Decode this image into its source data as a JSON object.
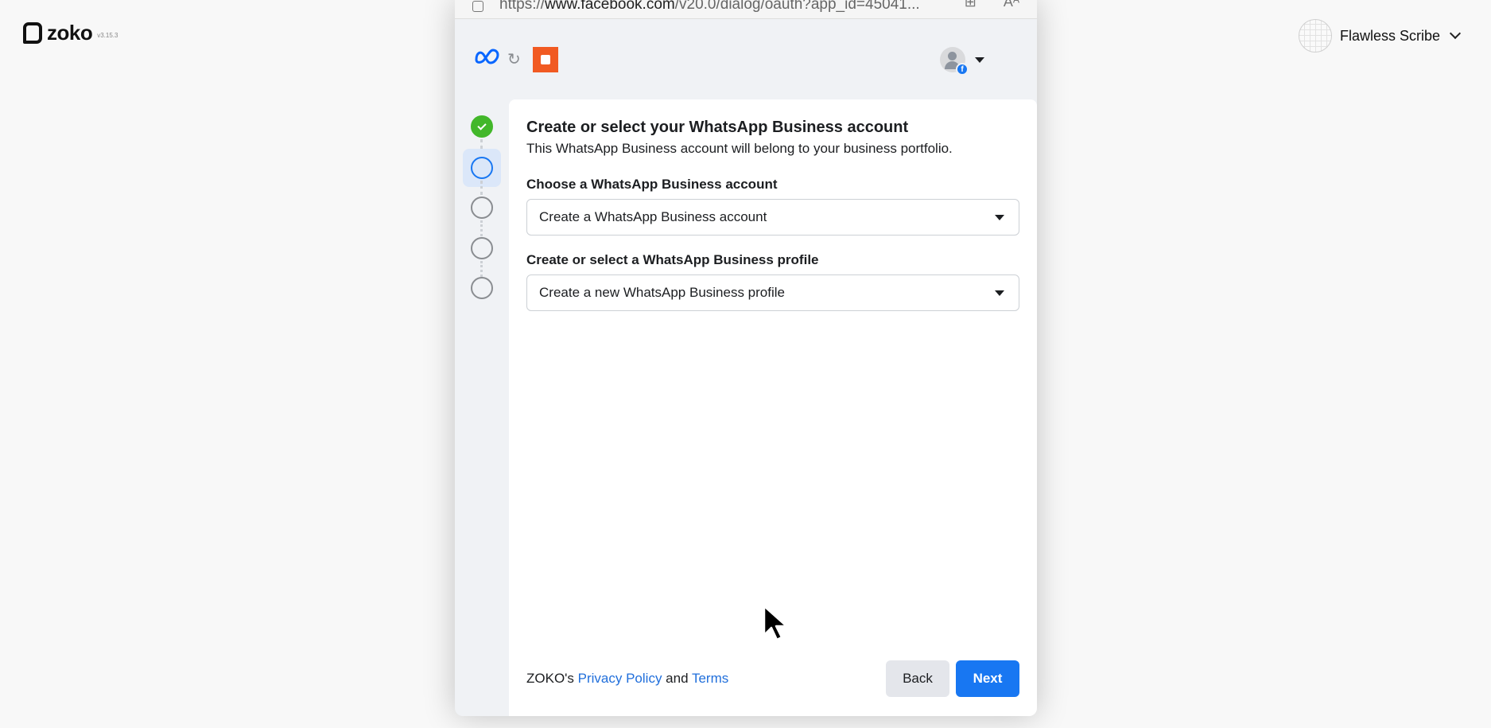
{
  "app": {
    "logo_text": "zoko",
    "version": "v3.15.3",
    "user_name": "Flawless Scribe"
  },
  "popup": {
    "url_prefix": "https://",
    "url_domain": "www.facebook.com",
    "url_path": "/v20.0/dialog/oauth?app_id=45041...",
    "swap_icon": "↻",
    "fb_badge": "f"
  },
  "steps": {
    "total": 5,
    "completed": 1,
    "current": 2
  },
  "card": {
    "title": "Create or select your WhatsApp Business account",
    "subtitle": "This WhatsApp Business account will belong to your business portfolio.",
    "account_label": "Choose a WhatsApp Business account",
    "account_value": "Create a WhatsApp Business account",
    "profile_label": "Create or select a WhatsApp Business profile",
    "profile_value": "Create a new WhatsApp Business profile"
  },
  "footer": {
    "owner": "ZOKO's ",
    "privacy_link": "Privacy Policy",
    "and": " and ",
    "terms_link": "Terms",
    "back_label": "Back",
    "next_label": "Next"
  },
  "colors": {
    "primary": "#1877f2",
    "success": "#42b72a",
    "link": "#216fdb",
    "brand_orange": "#f15a22"
  }
}
